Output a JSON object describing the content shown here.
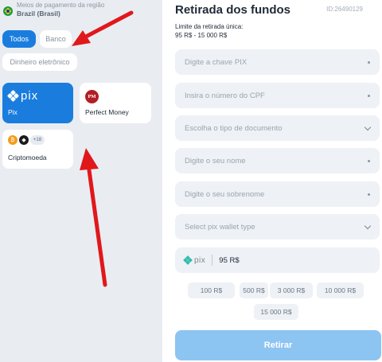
{
  "region": {
    "label": "Meios de pagamento da região",
    "value": "Brazil (Brasil)"
  },
  "filters": [
    {
      "label": "Todos",
      "active": true
    },
    {
      "label": "Banco",
      "active": false
    },
    {
      "label": "Dinheiro eletrônico",
      "active": false
    }
  ],
  "methods": {
    "pix": {
      "logo_text": "pix",
      "label": "Pix",
      "selected": true
    },
    "perfect_money": {
      "logo_text": "PM",
      "label": "Perfect Money"
    },
    "crypto": {
      "more_badge": "+18",
      "label": "Criptomoeda"
    }
  },
  "form": {
    "title": "Retirada dos fundos",
    "id": "ID:26490129",
    "limit_label": "Limite da retirada única:",
    "limit_value": "95 R$ - 15 000 R$",
    "fields": [
      {
        "placeholder": "Digite a chave PIX",
        "type": "text"
      },
      {
        "placeholder": "Insira o número do CPF",
        "type": "text"
      },
      {
        "placeholder": "Escolha o tipo de documento",
        "type": "select"
      },
      {
        "placeholder": "Digite o seu nome",
        "type": "text"
      },
      {
        "placeholder": "Digite o seu sobrenome",
        "type": "text"
      },
      {
        "placeholder": "Select pix wallet type",
        "type": "select"
      }
    ],
    "amount": {
      "logo_text": "pix",
      "value": "95 R$"
    },
    "quick_amounts": [
      "100 R$",
      "500 R$",
      "3 000 R$",
      "10 000 R$",
      "15 000 R$"
    ],
    "submit_label": "Retirar"
  },
  "colors": {
    "accent": "#1a7dde",
    "submit": "#8cc4f2",
    "annotation_arrow": "#e0181b"
  }
}
